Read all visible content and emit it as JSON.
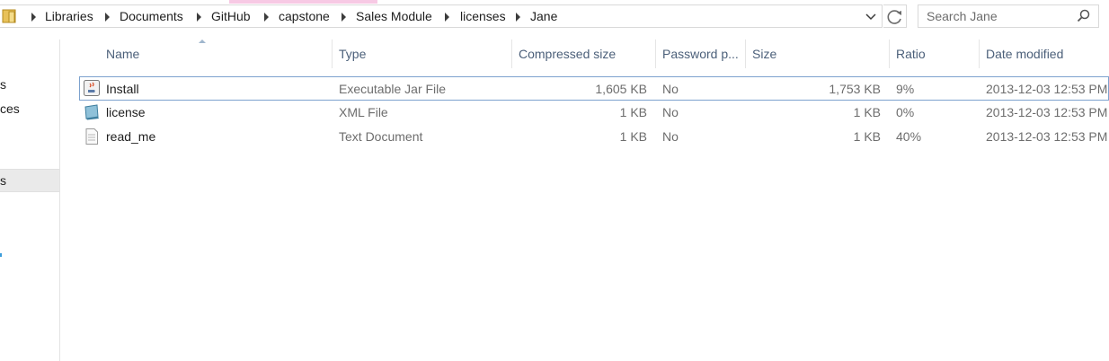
{
  "breadcrumb": [
    "Libraries",
    "Documents",
    "GitHub",
    "capstone",
    "Sales Module",
    "licenses",
    "Jane"
  ],
  "search": {
    "placeholder": "Search Jane"
  },
  "nav_pane": {
    "items": [
      "s",
      "ces",
      "s"
    ]
  },
  "columns": [
    "Name",
    "Type",
    "Compressed size",
    "Password p...",
    "Size",
    "Ratio",
    "Date modified"
  ],
  "files": [
    {
      "name": "Install",
      "icon": "java-jar-icon",
      "type": "Executable Jar File",
      "compressed": "1,605 KB",
      "password": "No",
      "size": "1,753 KB",
      "ratio": "9%",
      "modified": "2013-12-03 12:53 PM"
    },
    {
      "name": "license",
      "icon": "xml-file-icon",
      "type": "XML File",
      "compressed": "1 KB",
      "password": "No",
      "size": "1 KB",
      "ratio": "0%",
      "modified": "2013-12-03 12:53 PM"
    },
    {
      "name": "read_me",
      "icon": "text-document-icon",
      "type": "Text Document",
      "compressed": "1 KB",
      "password": "No",
      "size": "1 KB",
      "ratio": "40%",
      "modified": "2013-12-03 12:53 PM"
    }
  ],
  "colors": {
    "header_text": "#4c607a",
    "selection_border": "#7da2ce",
    "muted_text": "#6d6d6d"
  }
}
